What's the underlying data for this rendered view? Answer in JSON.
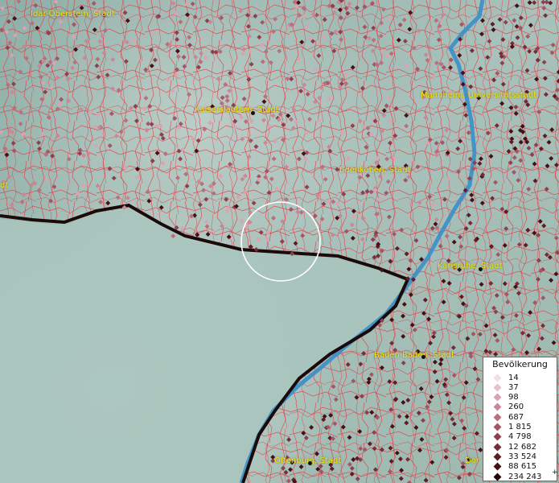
{
  "map": {
    "cities": [
      {
        "name": "Idar-Oberstein, Stadt"
      },
      {
        "name": "Kaiserslautern, Stadt"
      },
      {
        "name": "Mannheim, Universitätsstadt"
      },
      {
        "name": "Edenkoben, Stadt"
      },
      {
        "name": "Karlsruhe, Stadt"
      },
      {
        "name": "Baden-Baden, Stadt"
      },
      {
        "name": "Offenburg, Stadt"
      },
      {
        "name": "Dor"
      },
      {
        "name": "dt"
      }
    ]
  },
  "legend": {
    "title": "Bevölkerung",
    "plus": "+",
    "items": [
      {
        "label": "14",
        "color": "#f3dde6"
      },
      {
        "label": "37",
        "color": "#e8c0cc"
      },
      {
        "label": "98",
        "color": "#d9a3b2"
      },
      {
        "label": "260",
        "color": "#c98897"
      },
      {
        "label": "687",
        "color": "#b86f7e"
      },
      {
        "label": "1 815",
        "color": "#a35766"
      },
      {
        "label": "4 798",
        "color": "#8d404f"
      },
      {
        "label": "12 682",
        "color": "#772c39"
      },
      {
        "label": "33 524",
        "color": "#5e1c26"
      },
      {
        "label": "88 615",
        "color": "#451016"
      },
      {
        "label": "234 243",
        "color": "#1f060a"
      }
    ]
  }
}
